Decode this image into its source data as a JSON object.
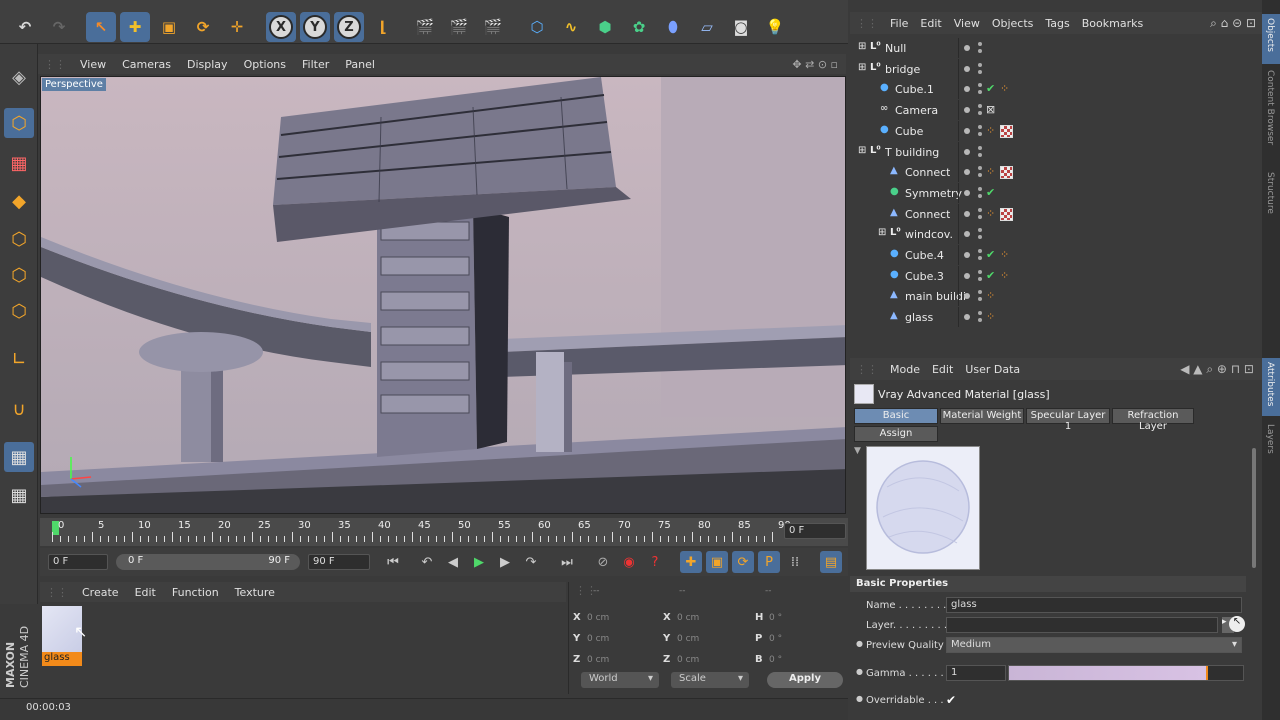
{
  "viewport": {
    "menu": [
      "View",
      "Cameras",
      "Display",
      "Options",
      "Filter",
      "Panel"
    ],
    "label": "Perspective"
  },
  "timeline": {
    "ticks": [
      "0",
      "5",
      "10",
      "15",
      "20",
      "25",
      "30",
      "35",
      "40",
      "45",
      "50",
      "55",
      "60",
      "65",
      "70",
      "75",
      "80",
      "85",
      "90"
    ],
    "current_frame": "0 F"
  },
  "transport": {
    "start": "0 F",
    "range_start": "0 F",
    "range_end": "90 F",
    "end": "90 F"
  },
  "material_manager": {
    "menu": [
      "Create",
      "Edit",
      "Function",
      "Texture"
    ],
    "materials": [
      {
        "name": "glass"
      }
    ]
  },
  "coordinates": {
    "headers": [
      "--",
      "--",
      "--"
    ],
    "rows": [
      {
        "a": "X",
        "av": "0 cm",
        "b": "X",
        "bv": "0 cm",
        "c": "H",
        "cv": "0 °"
      },
      {
        "a": "Y",
        "av": "0 cm",
        "b": "Y",
        "bv": "0 cm",
        "c": "P",
        "cv": "0 °"
      },
      {
        "a": "Z",
        "av": "0 cm",
        "b": "Z",
        "bv": "0 cm",
        "c": "B",
        "cv": "0 °"
      }
    ],
    "space": "World",
    "mode": "Scale",
    "apply": "Apply"
  },
  "object_manager": {
    "menu": [
      "File",
      "Edit",
      "View",
      "Objects",
      "Tags",
      "Bookmarks"
    ],
    "objects": [
      {
        "name": "Null",
        "indent": 0,
        "icon": "null-icon"
      },
      {
        "name": "bridge",
        "indent": 0,
        "icon": "null-icon"
      },
      {
        "name": "Cube.1",
        "indent": 1,
        "icon": "cube-icon"
      },
      {
        "name": "Camera",
        "indent": 1,
        "icon": "camera-icon"
      },
      {
        "name": "Cube",
        "indent": 1,
        "icon": "cube-icon"
      },
      {
        "name": "T building",
        "indent": 0,
        "icon": "null-icon"
      },
      {
        "name": "Connect",
        "indent": 2,
        "icon": "connect-icon"
      },
      {
        "name": "Symmetry",
        "indent": 2,
        "icon": "symmetry-icon"
      },
      {
        "name": "Connect",
        "indent": 2,
        "icon": "connect-icon"
      },
      {
        "name": "windcov.",
        "indent": 2,
        "icon": "null-icon"
      },
      {
        "name": "Cube.4",
        "indent": 2,
        "icon": "cube-icon"
      },
      {
        "name": "Cube.3",
        "indent": 2,
        "icon": "cube-icon"
      },
      {
        "name": "main buildin",
        "indent": 2,
        "icon": "connect-icon"
      },
      {
        "name": "glass",
        "indent": 2,
        "icon": "connect-icon"
      }
    ]
  },
  "attribute_manager": {
    "menu": [
      "Mode",
      "Edit",
      "User Data"
    ],
    "title": "Vray Advanced Material [glass]",
    "tabs": [
      "Basic",
      "Material Weight",
      "Specular Layer 1",
      "Refraction Layer",
      "Assign"
    ],
    "section": "Basic Properties",
    "name_label": "Name . . . . . . . .",
    "name_value": "glass",
    "layer_label": "Layer. . . . . . . . .",
    "preview_label": "Preview Quality",
    "preview_value": "Medium",
    "gamma_label": "Gamma . . . . . .",
    "gamma_value": "1",
    "gamma_fraction": 0.85,
    "overridable_label": "Overridable . . .",
    "overridable_check": "✔"
  },
  "right_strip": [
    "Objects",
    "Content Browser",
    "Structure",
    "Attributes",
    "Layers"
  ],
  "status": {
    "time": "00:00:03"
  },
  "brand": {
    "line1": "MAXON",
    "line2": "CINEMA 4D"
  }
}
